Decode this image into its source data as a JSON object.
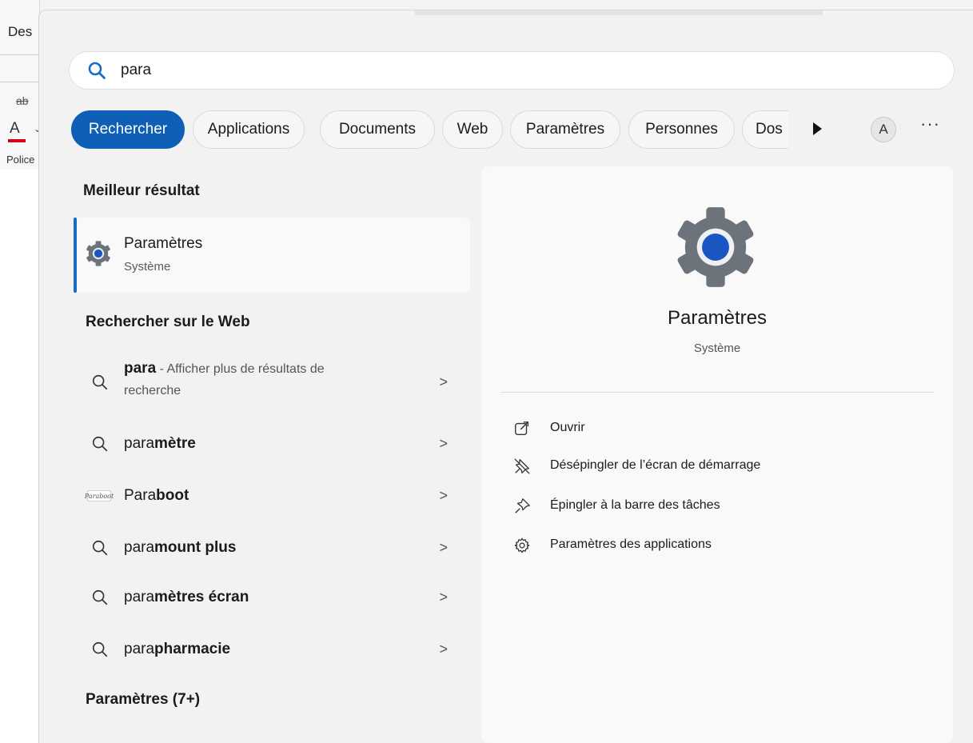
{
  "background_app": {
    "tab_label": "Des",
    "strike_label": "ab",
    "font_color_label": "A",
    "caret": "⌄",
    "group_label": "Police"
  },
  "search": {
    "query": "para"
  },
  "tabs": [
    {
      "label": "Rechercher",
      "active": true
    },
    {
      "label": "Applications",
      "active": false
    },
    {
      "label": "Documents",
      "active": false
    },
    {
      "label": "Web",
      "active": false
    },
    {
      "label": "Paramètres",
      "active": false
    },
    {
      "label": "Personnes",
      "active": false
    },
    {
      "label": "Dos",
      "active": false
    }
  ],
  "account": {
    "avatar_letter": "A",
    "more_label": "···"
  },
  "best_match": {
    "section_title": "Meilleur résultat",
    "name": "Paramètres",
    "subtitle": "Système",
    "icon": "settings-gear-icon"
  },
  "web": {
    "section_title": "Rechercher sur le Web",
    "items": [
      {
        "bold": "para",
        "rest": " - Afficher plus de résultats de",
        "line2": "recherche",
        "icon": "search-icon",
        "chevron": ">"
      },
      {
        "plain": "para",
        "bold": "mètre",
        "icon": "search-icon",
        "chevron": ">"
      },
      {
        "plain": "Para",
        "bold": "boot",
        "icon": "paraboot-logo-icon",
        "logo_text": "Paraboot",
        "chevron": ">"
      },
      {
        "plain": "para",
        "bold": "mount plus",
        "icon": "search-icon",
        "chevron": ">"
      },
      {
        "plain": "para",
        "bold": "mètres écran",
        "icon": "search-icon",
        "chevron": ">"
      },
      {
        "plain": "para",
        "bold": "pharmacie",
        "icon": "search-icon",
        "chevron": ">"
      }
    ]
  },
  "settings_section": {
    "title": "Paramètres (7+)"
  },
  "preview": {
    "title": "Paramètres",
    "subtitle": "Système",
    "actions": [
      {
        "label": "Ouvrir",
        "icon": "open-external-icon"
      },
      {
        "label": "Désépingler de l’écran de démarrage",
        "icon": "unpin-icon"
      },
      {
        "label": "Épingler à la barre des tâches",
        "icon": "pin-icon"
      },
      {
        "label": "Paramètres des applications",
        "icon": "gear-icon"
      }
    ]
  },
  "colors": {
    "accent": "#0f5fb6",
    "accent_bar": "#1a6bc6",
    "search_icon": "#1a6bc6",
    "gear_gray": "#6d737a",
    "gear_center": "#1a56c2"
  }
}
